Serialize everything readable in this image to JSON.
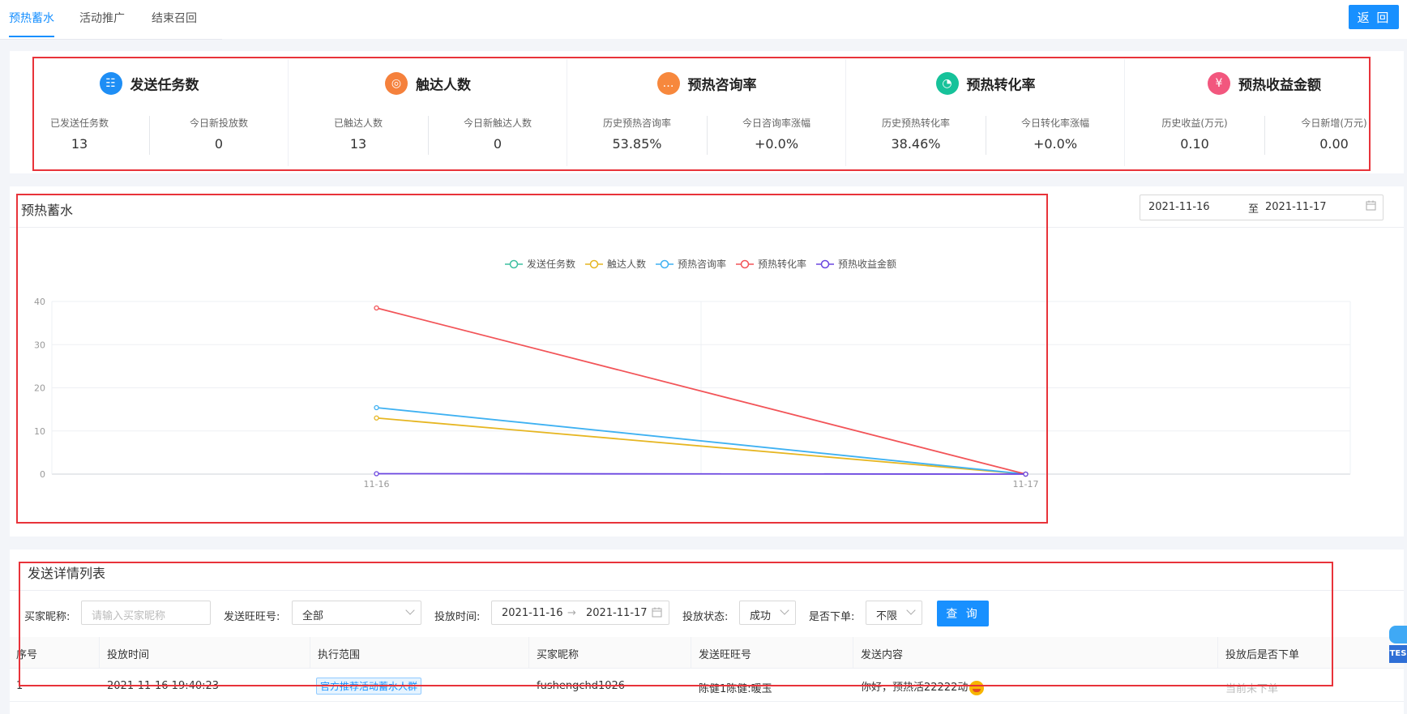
{
  "tabs": [
    {
      "label": "预热蓄水",
      "active": true
    },
    {
      "label": "活动推广",
      "active": false
    },
    {
      "label": "结束召回",
      "active": false
    }
  ],
  "back_label": "返 回",
  "stats": [
    {
      "title": "发送任务数",
      "icon": "task-list-icon",
      "color": "#1e8ef5",
      "subs": [
        {
          "label": "已发送任务数",
          "value": "13"
        },
        {
          "label": "今日新投放数",
          "value": "0"
        }
      ]
    },
    {
      "title": "触达人数",
      "icon": "target-icon",
      "color": "#f5813c",
      "subs": [
        {
          "label": "已触达人数",
          "value": "13"
        },
        {
          "label": "今日新触达人数",
          "value": "0"
        }
      ]
    },
    {
      "title": "预热咨询率",
      "icon": "chat-icon",
      "color": "#f7883d",
      "subs": [
        {
          "label": "历史预热咨询率",
          "value": "53.85%"
        },
        {
          "label": "今日咨询率涨幅",
          "value": "+0.0%"
        }
      ]
    },
    {
      "title": "预热转化率",
      "icon": "pie-icon",
      "color": "#16c29a",
      "subs": [
        {
          "label": "历史预热转化率",
          "value": "38.46%"
        },
        {
          "label": "今日转化率涨幅",
          "value": "+0.0%"
        }
      ]
    },
    {
      "title": "预热收益金额",
      "icon": "money-bag-icon",
      "color": "#f2577e",
      "subs": [
        {
          "label": "历史收益(万元)",
          "value": "0.10"
        },
        {
          "label": "今日新增(万元)",
          "value": "0.00"
        }
      ]
    }
  ],
  "chart_section": {
    "title": "预热蓄水",
    "date_start": "2021-11-16",
    "date_sep": "至",
    "date_end": "2021-11-17"
  },
  "chart_data": {
    "type": "line",
    "x": [
      "11-16",
      "11-17"
    ],
    "ylim": [
      0,
      40
    ],
    "yticks": [
      0,
      10,
      20,
      30,
      40
    ],
    "grid": true,
    "legend": "top-center",
    "series": [
      {
        "name": "发送任务数",
        "color": "#3dbfa0",
        "values": [
          null,
          0
        ]
      },
      {
        "name": "触达人数",
        "color": "#e6b622",
        "values": [
          13,
          0
        ]
      },
      {
        "name": "预热咨询率",
        "color": "#3fb1f2",
        "values": [
          15.4,
          0
        ]
      },
      {
        "name": "预热转化率",
        "color": "#f25458",
        "values": [
          38.5,
          0
        ]
      },
      {
        "name": "预热收益金额",
        "color": "#6b46e0",
        "values": [
          0.1,
          0
        ]
      }
    ]
  },
  "list_section": {
    "title": "发送详情列表",
    "filters": {
      "buyer_label": "买家昵称:",
      "buyer_placeholder": "请输入买家昵称",
      "wangwang_label": "发送旺旺号:",
      "wangwang_value": "全部",
      "time_label": "投放时间:",
      "time_start": "2021-11-16",
      "time_arrow": "→",
      "time_end": "2021-11-17",
      "status_label": "投放状态:",
      "status_value": "成功",
      "order_label": "是否下单:",
      "order_value": "不限",
      "query_label": "查 询"
    },
    "columns": [
      "序号",
      "投放时间",
      "执行范围",
      "买家昵称",
      "发送旺旺号",
      "发送内容",
      "投放后是否下单"
    ],
    "rows": [
      {
        "index": "1",
        "time": "2021-11-16 19:40:23",
        "scope": "官方推荐活动蓄水人群",
        "buyer": "fushengchd1026",
        "wangwang": "陈健1陈健:暖玉",
        "content": "你好，预热活22222动",
        "ordered": "当前未下单"
      }
    ]
  },
  "robot_label": "TES"
}
